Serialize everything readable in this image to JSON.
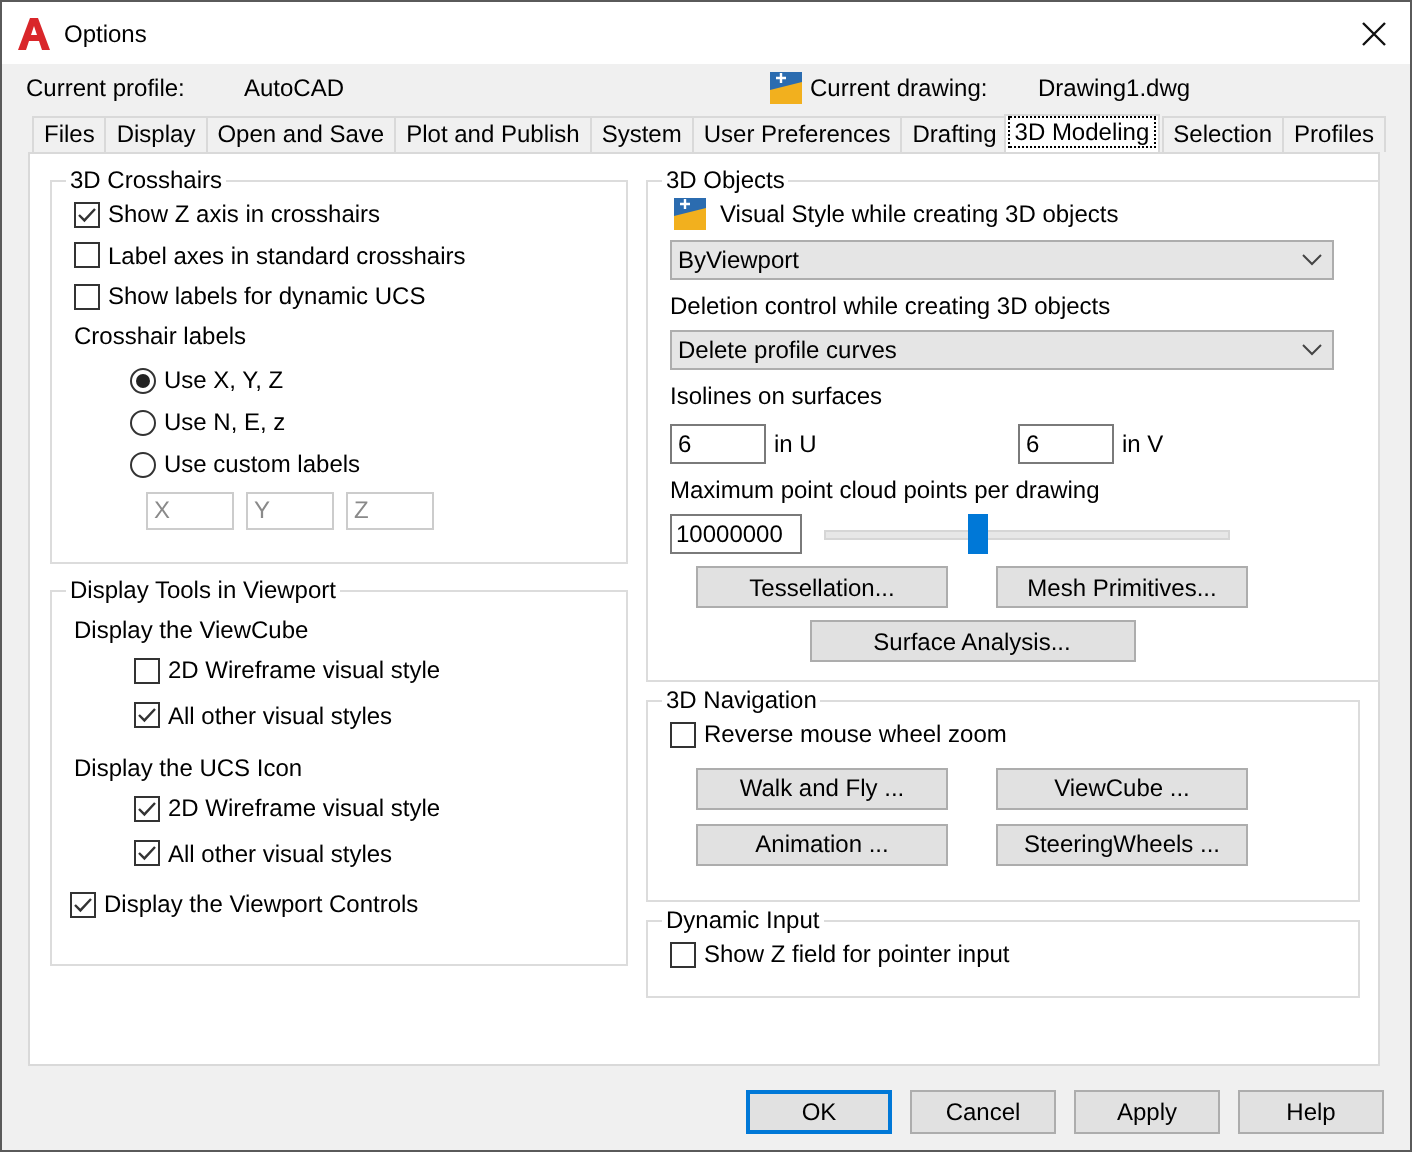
{
  "window": {
    "title": "Options"
  },
  "profile": {
    "label": "Current profile:",
    "value": "AutoCAD"
  },
  "drawing": {
    "label": "Current drawing:",
    "value": "Drawing1.dwg"
  },
  "tabs": [
    {
      "label": "Files",
      "selected": false
    },
    {
      "label": "Display",
      "selected": false
    },
    {
      "label": "Open and Save",
      "selected": false
    },
    {
      "label": "Plot and Publish",
      "selected": false
    },
    {
      "label": "System",
      "selected": false
    },
    {
      "label": "User Preferences",
      "selected": false
    },
    {
      "label": "Drafting",
      "selected": false
    },
    {
      "label": "3D Modeling",
      "selected": true
    },
    {
      "label": "Selection",
      "selected": false
    },
    {
      "label": "Profiles",
      "selected": false
    }
  ],
  "crosshairs": {
    "title": "3D Crosshairs",
    "checkboxes": [
      {
        "label": "Show Z axis in crosshairs",
        "checked": true
      },
      {
        "label": "Label axes in standard crosshairs",
        "checked": false
      },
      {
        "label": "Show labels for dynamic UCS",
        "checked": false
      }
    ],
    "labels_heading": "Crosshair labels",
    "radios": [
      {
        "label": "Use X, Y, Z",
        "selected": true
      },
      {
        "label": "Use N, E, z",
        "selected": false
      },
      {
        "label": "Use custom labels",
        "selected": false
      }
    ],
    "custom_fields": [
      {
        "value": "X",
        "disabled": true
      },
      {
        "value": "Y",
        "disabled": true
      },
      {
        "value": "Z",
        "disabled": true
      }
    ]
  },
  "display_tools": {
    "title": "Display Tools in Viewport",
    "sections": [
      {
        "heading": "Display the ViewCube",
        "checkboxes": [
          {
            "label": "2D Wireframe visual style",
            "checked": false
          },
          {
            "label": "All other visual styles",
            "checked": true
          }
        ]
      },
      {
        "heading": "Display the UCS Icon",
        "checkboxes": [
          {
            "label": "2D Wireframe visual style",
            "checked": true
          },
          {
            "label": "All other visual styles",
            "checked": true
          }
        ]
      }
    ],
    "viewport_controls": {
      "label": "Display the Viewport Controls",
      "checked": true
    }
  },
  "objects": {
    "title": "3D Objects",
    "visual_style": {
      "label": "Visual Style while creating 3D objects",
      "value": "ByViewport"
    },
    "deletion": {
      "label": "Deletion control while creating 3D objects",
      "value": "Delete profile curves"
    },
    "isolines": {
      "label": "Isolines on surfaces",
      "u": {
        "value": "6",
        "label": "in U"
      },
      "v": {
        "value": "6",
        "label": "in V"
      }
    },
    "point_cloud": {
      "label": "Maximum point cloud points per drawing",
      "value": "10000000",
      "level": 0.38
    },
    "buttons": [
      "Tessellation...",
      "Mesh Primitives...",
      "Surface Analysis..."
    ]
  },
  "navigation": {
    "title": "3D Navigation",
    "reverse_zoom": {
      "label": "Reverse mouse wheel zoom",
      "checked": false
    },
    "buttons": [
      "Walk and Fly ...",
      "ViewCube ...",
      "Animation ...",
      "SteeringWheels ..."
    ]
  },
  "dynamic_input": {
    "title": "Dynamic Input",
    "show_z": {
      "label": "Show Z field for pointer input",
      "checked": false
    }
  },
  "buttons": [
    {
      "label": "OK",
      "default": true
    },
    {
      "label": "Cancel",
      "default": false
    },
    {
      "label": "Apply",
      "default": false
    },
    {
      "label": "Help",
      "default": false
    }
  ]
}
